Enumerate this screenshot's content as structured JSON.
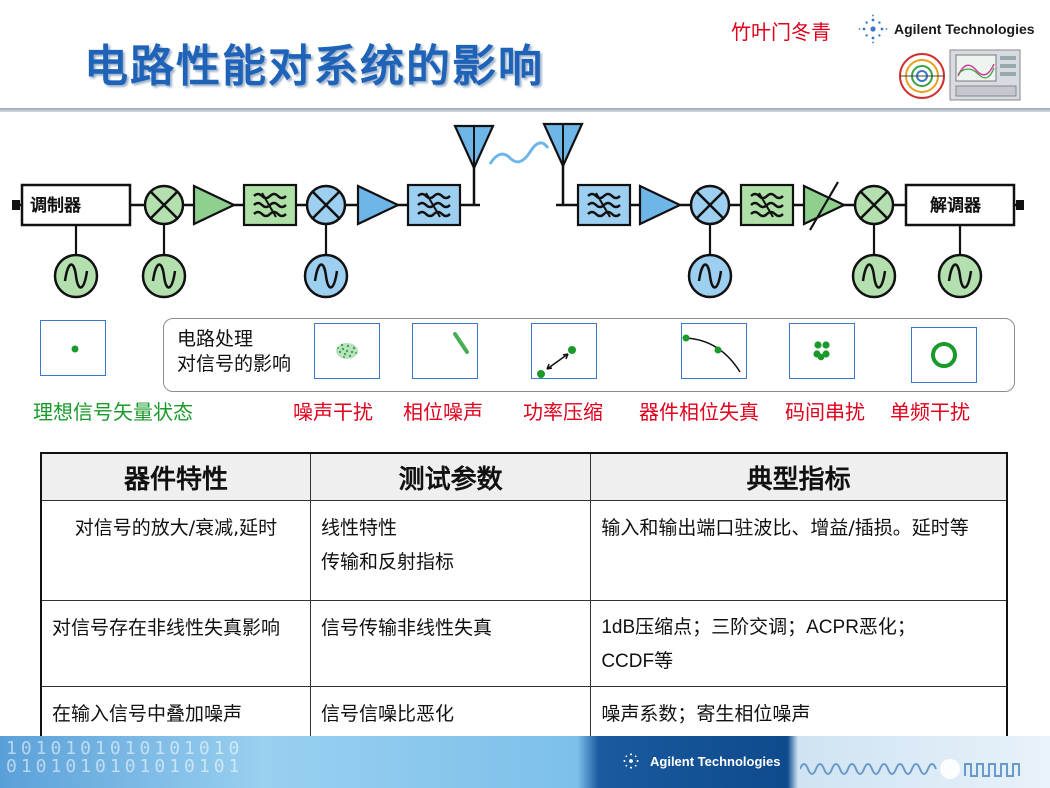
{
  "header": {
    "title": "电路性能对系统的影响",
    "author": "竹叶门冬青",
    "brand": "Agilent Technologies"
  },
  "diagram": {
    "modulator_label": "调制器",
    "demodulator_label": "解调器"
  },
  "effects": {
    "ideal_caption": "理想信号矢量状态",
    "panel_label_line1": "电路处理",
    "panel_label_line2": "对信号的影响",
    "items": [
      {
        "caption": "噪声干扰"
      },
      {
        "caption": "相位噪声"
      },
      {
        "caption": "功率压缩"
      },
      {
        "caption": "器件相位失真"
      },
      {
        "caption": "码间串扰"
      },
      {
        "caption": "单频干扰"
      }
    ]
  },
  "table": {
    "headers": [
      "器件特性",
      "测试参数",
      "典型指标"
    ],
    "rows": [
      {
        "c1": "对信号的放大/衰减,延时",
        "c2a": "线性特性",
        "c2b": "传输和反射指标",
        "c3a": "输入和输出端口驻波比、增益/插损。延时等",
        "c3b": ""
      },
      {
        "c1": "对信号存在非线性失真影响",
        "c2a": "信号传输非线性失真",
        "c2b": "",
        "c3a": "1dB压缩点；三阶交调；ACPR恶化；",
        "c3b": "CCDF等"
      },
      {
        "c1": "在输入信号中叠加噪声",
        "c2a": "信号信噪比恶化",
        "c2b": "",
        "c3a": "噪声系数；寄生相位噪声",
        "c3b": ""
      }
    ]
  },
  "footer": {
    "brand": "Agilent Technologies",
    "digits_line1": "1010101010101010",
    "digits_line2": "0101010101010101"
  },
  "colors": {
    "title_blue": "#1f63b8",
    "caption_red": "#e0001b",
    "ideal_green": "#1a9a2a",
    "amp_green": "#8fd08f",
    "amp_blue": "#6fb6e8",
    "filter_green": "#aee0a8",
    "filter_blue": "#9ccff0"
  }
}
